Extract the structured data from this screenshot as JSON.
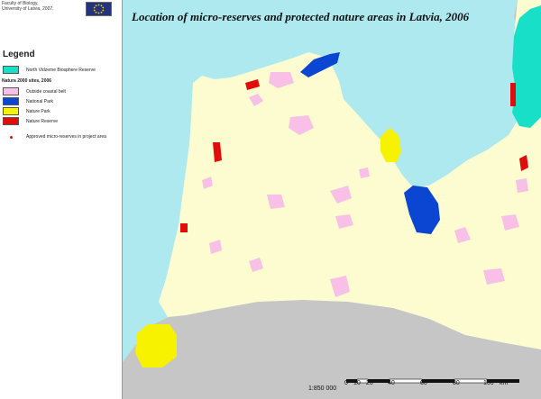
{
  "credit": {
    "line1": "Faculty of Biology,",
    "line2": "University of Latvia, 2007."
  },
  "map": {
    "title": "Location of micro-reserves and protected nature areas in Latvia, 2006",
    "colors": {
      "sea": "#aee9f0",
      "land_latvia": "#fcfcd0",
      "foreign_land": "#c6c6c6",
      "outside_coastal_belt": "#f8c0e6",
      "national_park": "#0a46d2",
      "nature_park": "#f7f200",
      "nature_reserve": "#e10c0c",
      "biosphere_reserve": "#18e0c8"
    }
  },
  "legend": {
    "title": "Legend",
    "items": [
      {
        "label": "North Vidzeme Biosphere Reserve",
        "color": "#18e0c8",
        "icon": "swatch"
      },
      {
        "label": "Natura 2000 sites, 2006",
        "heading": true
      },
      {
        "label": "Outside coastal belt",
        "color": "#f8c0e6",
        "icon": "swatch"
      },
      {
        "label": "National Park",
        "color": "#0a46d2",
        "icon": "swatch"
      },
      {
        "label": "Nature Park",
        "color": "#f7f200",
        "icon": "swatch"
      },
      {
        "label": "Nature Reserve",
        "color": "#e10c0c",
        "icon": "swatch"
      },
      {
        "label": "Approved micro-reserves in project area",
        "color": "#e10c0c",
        "icon": "dot"
      }
    ]
  },
  "scale": {
    "ratio": "1:850 000",
    "ticks": [
      "0",
      "10",
      "20",
      "40",
      "60",
      "80",
      "100"
    ],
    "unit": "km"
  }
}
